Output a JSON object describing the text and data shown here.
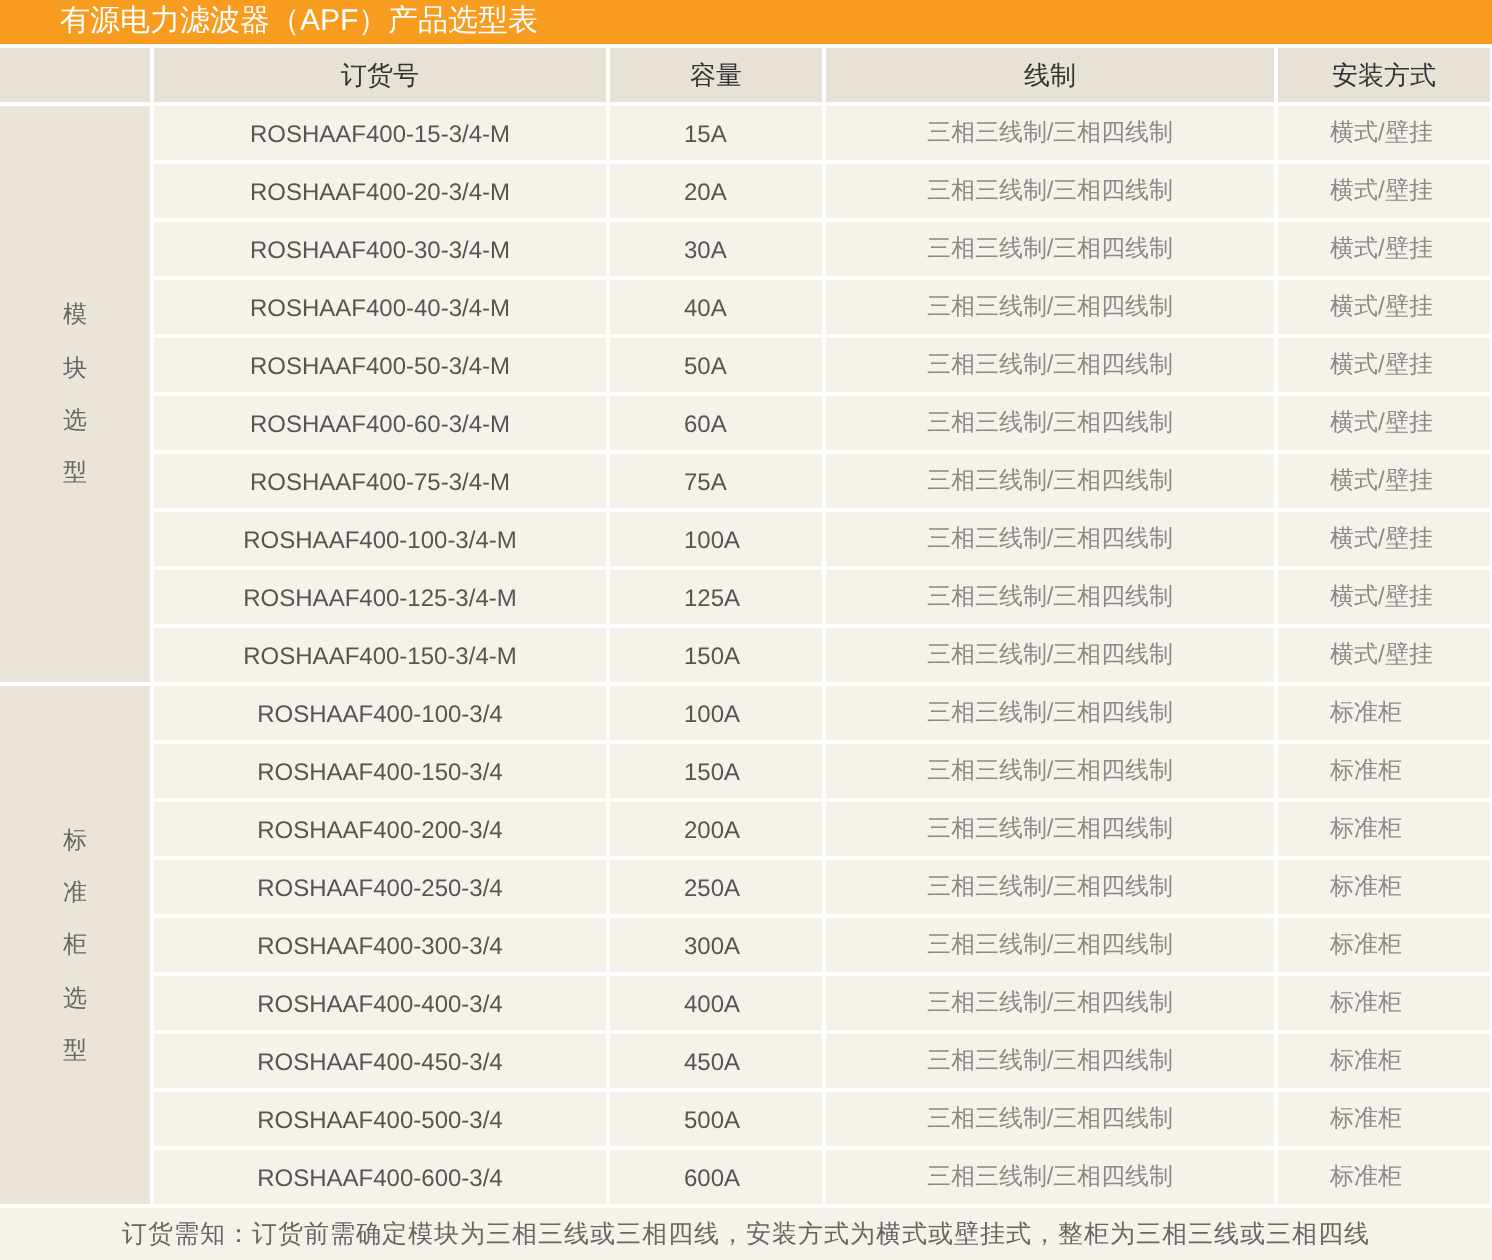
{
  "title": "有源电力滤波器（APF）产品选型表",
  "columns": [
    "订货号",
    "容量",
    "线制",
    "安装方式"
  ],
  "groups": [
    {
      "label": "模块选型",
      "rows": [
        {
          "order_no": "ROSHAAF400-15-3/4-M",
          "capacity": "15A",
          "wiring": "三相三线制/三相四线制",
          "mounting": "横式/壁挂"
        },
        {
          "order_no": "ROSHAAF400-20-3/4-M",
          "capacity": "20A",
          "wiring": "三相三线制/三相四线制",
          "mounting": "横式/壁挂"
        },
        {
          "order_no": "ROSHAAF400-30-3/4-M",
          "capacity": "30A",
          "wiring": "三相三线制/三相四线制",
          "mounting": "横式/壁挂"
        },
        {
          "order_no": "ROSHAAF400-40-3/4-M",
          "capacity": "40A",
          "wiring": "三相三线制/三相四线制",
          "mounting": "横式/壁挂"
        },
        {
          "order_no": "ROSHAAF400-50-3/4-M",
          "capacity": "50A",
          "wiring": "三相三线制/三相四线制",
          "mounting": "横式/壁挂"
        },
        {
          "order_no": "ROSHAAF400-60-3/4-M",
          "capacity": "60A",
          "wiring": "三相三线制/三相四线制",
          "mounting": "横式/壁挂"
        },
        {
          "order_no": "ROSHAAF400-75-3/4-M",
          "capacity": "75A",
          "wiring": "三相三线制/三相四线制",
          "mounting": "横式/壁挂"
        },
        {
          "order_no": "ROSHAAF400-100-3/4-M",
          "capacity": "100A",
          "wiring": "三相三线制/三相四线制",
          "mounting": "横式/壁挂"
        },
        {
          "order_no": "ROSHAAF400-125-3/4-M",
          "capacity": "125A",
          "wiring": "三相三线制/三相四线制",
          "mounting": "横式/壁挂"
        },
        {
          "order_no": "ROSHAAF400-150-3/4-M",
          "capacity": "150A",
          "wiring": "三相三线制/三相四线制",
          "mounting": "横式/壁挂"
        }
      ]
    },
    {
      "label": "标准柜选型",
      "rows": [
        {
          "order_no": "ROSHAAF400-100-3/4",
          "capacity": "100A",
          "wiring": "三相三线制/三相四线制",
          "mounting": "标准柜"
        },
        {
          "order_no": "ROSHAAF400-150-3/4",
          "capacity": "150A",
          "wiring": "三相三线制/三相四线制",
          "mounting": "标准柜"
        },
        {
          "order_no": "ROSHAAF400-200-3/4",
          "capacity": "200A",
          "wiring": "三相三线制/三相四线制",
          "mounting": "标准柜"
        },
        {
          "order_no": "ROSHAAF400-250-3/4",
          "capacity": "250A",
          "wiring": "三相三线制/三相四线制",
          "mounting": "标准柜"
        },
        {
          "order_no": "ROSHAAF400-300-3/4",
          "capacity": "300A",
          "wiring": "三相三线制/三相四线制",
          "mounting": "标准柜"
        },
        {
          "order_no": "ROSHAAF400-400-3/4",
          "capacity": "400A",
          "wiring": "三相三线制/三相四线制",
          "mounting": "标准柜"
        },
        {
          "order_no": "ROSHAAF400-450-3/4",
          "capacity": "450A",
          "wiring": "三相三线制/三相四线制",
          "mounting": "标准柜"
        },
        {
          "order_no": "ROSHAAF400-500-3/4",
          "capacity": "500A",
          "wiring": "三相三线制/三相四线制",
          "mounting": "标准柜"
        },
        {
          "order_no": "ROSHAAF400-600-3/4",
          "capacity": "600A",
          "wiring": "三相三线制/三相四线制",
          "mounting": "标准柜"
        }
      ]
    }
  ],
  "note": "订货需知：订货前需确定模块为三相三线或三相四线，安装方式为横式或壁挂式，整柜为三相三线或三相四线"
}
